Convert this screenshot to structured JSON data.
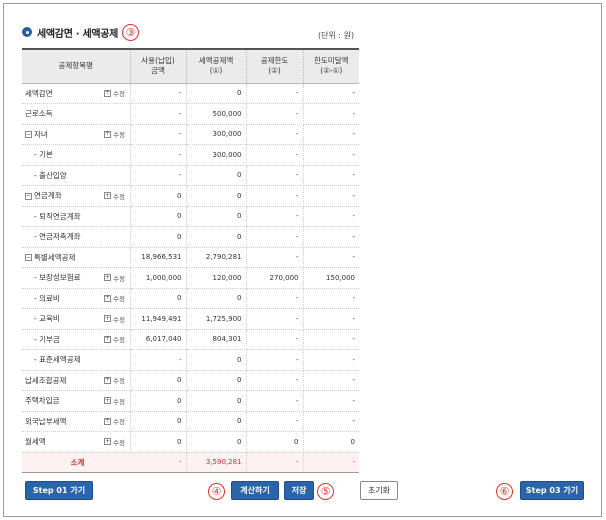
{
  "title": "세액감면 · 세액공제",
  "unit": "(단위 : 원)",
  "markers": {
    "title": "③",
    "calc": "④",
    "save": "⑤",
    "next": "⑥"
  },
  "icons": {
    "title_bullet": "circle-bullet-icon",
    "expand": "plus-box-icon",
    "collapse": "minus-box-icon"
  },
  "colors": {
    "accent": "#2a64aa",
    "marker": "#e0322a",
    "total_row": "#fdf1f1"
  },
  "columns": {
    "name": "공제항목명",
    "used": "사용(납입)\n금액",
    "deduction": "세액공제액\n(①)",
    "limit": "공제한도\n(②)",
    "over": "한도미달액\n(②-①)"
  },
  "edit_label": "수정",
  "rows": [
    {
      "name": "세액감면",
      "edit": true,
      "used": "-",
      "deduction": "0",
      "limit": "-",
      "over": "-"
    },
    {
      "name": "근로소득",
      "edit": false,
      "used": "-",
      "deduction": "500,000",
      "limit": "-",
      "over": "-"
    },
    {
      "name": "자녀",
      "edit": true,
      "used": "-",
      "deduction": "300,000",
      "limit": "-",
      "over": "-"
    },
    {
      "name": "- 기본",
      "edit": false,
      "used": "-",
      "deduction": "300,000",
      "limit": "-",
      "over": "-"
    },
    {
      "name": "- 출산입양",
      "edit": false,
      "used": "-",
      "deduction": "0",
      "limit": "-",
      "over": "-"
    },
    {
      "name": "연금계좌",
      "edit": true,
      "used": "0",
      "deduction": "0",
      "limit": "-",
      "over": "-"
    },
    {
      "name": "- 퇴직연금계좌",
      "edit": false,
      "used": "0",
      "deduction": "0",
      "limit": "-",
      "over": "-"
    },
    {
      "name": "- 연금저축계좌",
      "edit": false,
      "used": "0",
      "deduction": "0",
      "limit": "-",
      "over": "-"
    },
    {
      "name": "특별세액공제",
      "edit": false,
      "used": "18,966,531",
      "deduction": "2,790,281",
      "limit": "-",
      "over": "-"
    },
    {
      "name": "- 보장성보험료",
      "edit": true,
      "used": "1,000,000",
      "deduction": "120,000",
      "limit": "270,000",
      "over": "150,000"
    },
    {
      "name": "- 의료비",
      "edit": true,
      "used": "0",
      "deduction": "0",
      "limit": "-",
      "over": "-"
    },
    {
      "name": "- 교육비",
      "edit": true,
      "used": "11,949,491",
      "deduction": "1,725,900",
      "limit": "-",
      "over": "-"
    },
    {
      "name": "- 기부금",
      "edit": true,
      "used": "6,017,040",
      "deduction": "804,301",
      "limit": "-",
      "over": "-"
    },
    {
      "name": "- 표준세액공제",
      "edit": false,
      "used": "-",
      "deduction": "0",
      "limit": "-",
      "over": "-"
    },
    {
      "name": "납세조합공제",
      "edit": true,
      "used": "0",
      "deduction": "0",
      "limit": "-",
      "over": "-"
    },
    {
      "name": "주택차입금",
      "edit": true,
      "used": "0",
      "deduction": "0",
      "limit": "-",
      "over": "-"
    },
    {
      "name": "외국납부세액",
      "edit": true,
      "used": "0",
      "deduction": "0",
      "limit": "-",
      "over": "-"
    },
    {
      "name": "월세액",
      "edit": true,
      "used": "0",
      "deduction": "0",
      "limit": "0",
      "over": "0"
    }
  ],
  "total": {
    "name": "소계",
    "used": "-",
    "deduction": "3,590,281",
    "limit": "-",
    "over": "-"
  },
  "buttons": {
    "prev": "Step 01 가기",
    "calc": "계산하기",
    "save": "저장",
    "reset": "초기화",
    "next": "Step 03 가기"
  }
}
